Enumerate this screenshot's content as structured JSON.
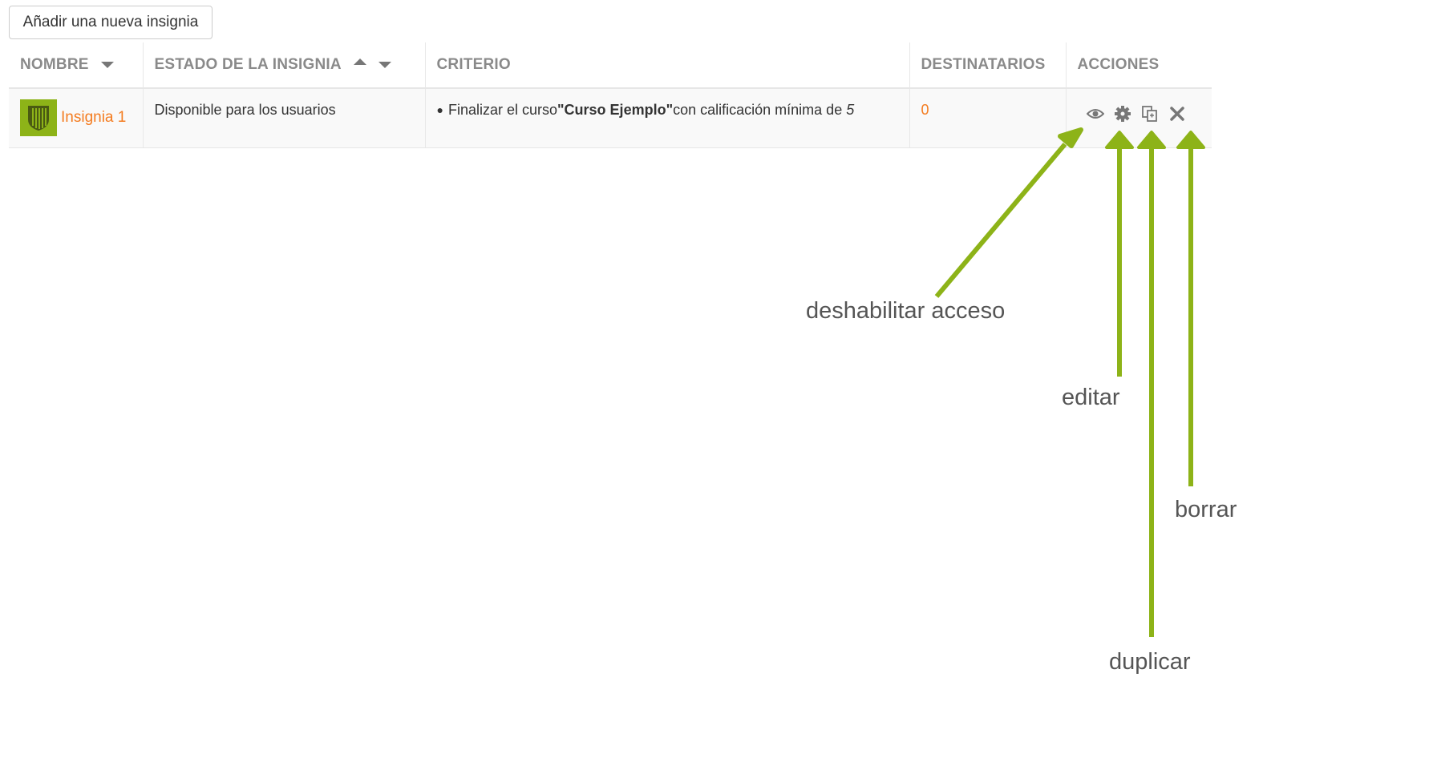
{
  "add_button": {
    "label": "Añadir una nueva insignia"
  },
  "table": {
    "headers": {
      "name": "NOMBRE",
      "status": "ESTADO DE LA INSIGNIA",
      "criteria": "CRITERIO",
      "recipients": "DESTINATARIOS",
      "actions": "ACCIONES"
    },
    "rows": [
      {
        "name": "Insignia 1",
        "status": "Disponible para los usuarios",
        "criteria_prefix": "Finalizar el curso",
        "criteria_course": "\"Curso Ejemplo\"",
        "criteria_suffix": "con calificación mínima de ",
        "criteria_grade": "5",
        "recipients": "0"
      }
    ]
  },
  "annotations": {
    "disable": "deshabilitar acceso",
    "edit": "editar",
    "duplicate": "duplicar",
    "delete": "borrar"
  },
  "colors": {
    "accent_green": "#8db318",
    "link_orange": "#f47c20",
    "header_gray": "#8a8a8a"
  },
  "icons": [
    "eye-icon",
    "gear-icon",
    "copy-icon",
    "close-icon",
    "sort-down-icon",
    "sort-up-icon",
    "badge-shield-icon"
  ]
}
